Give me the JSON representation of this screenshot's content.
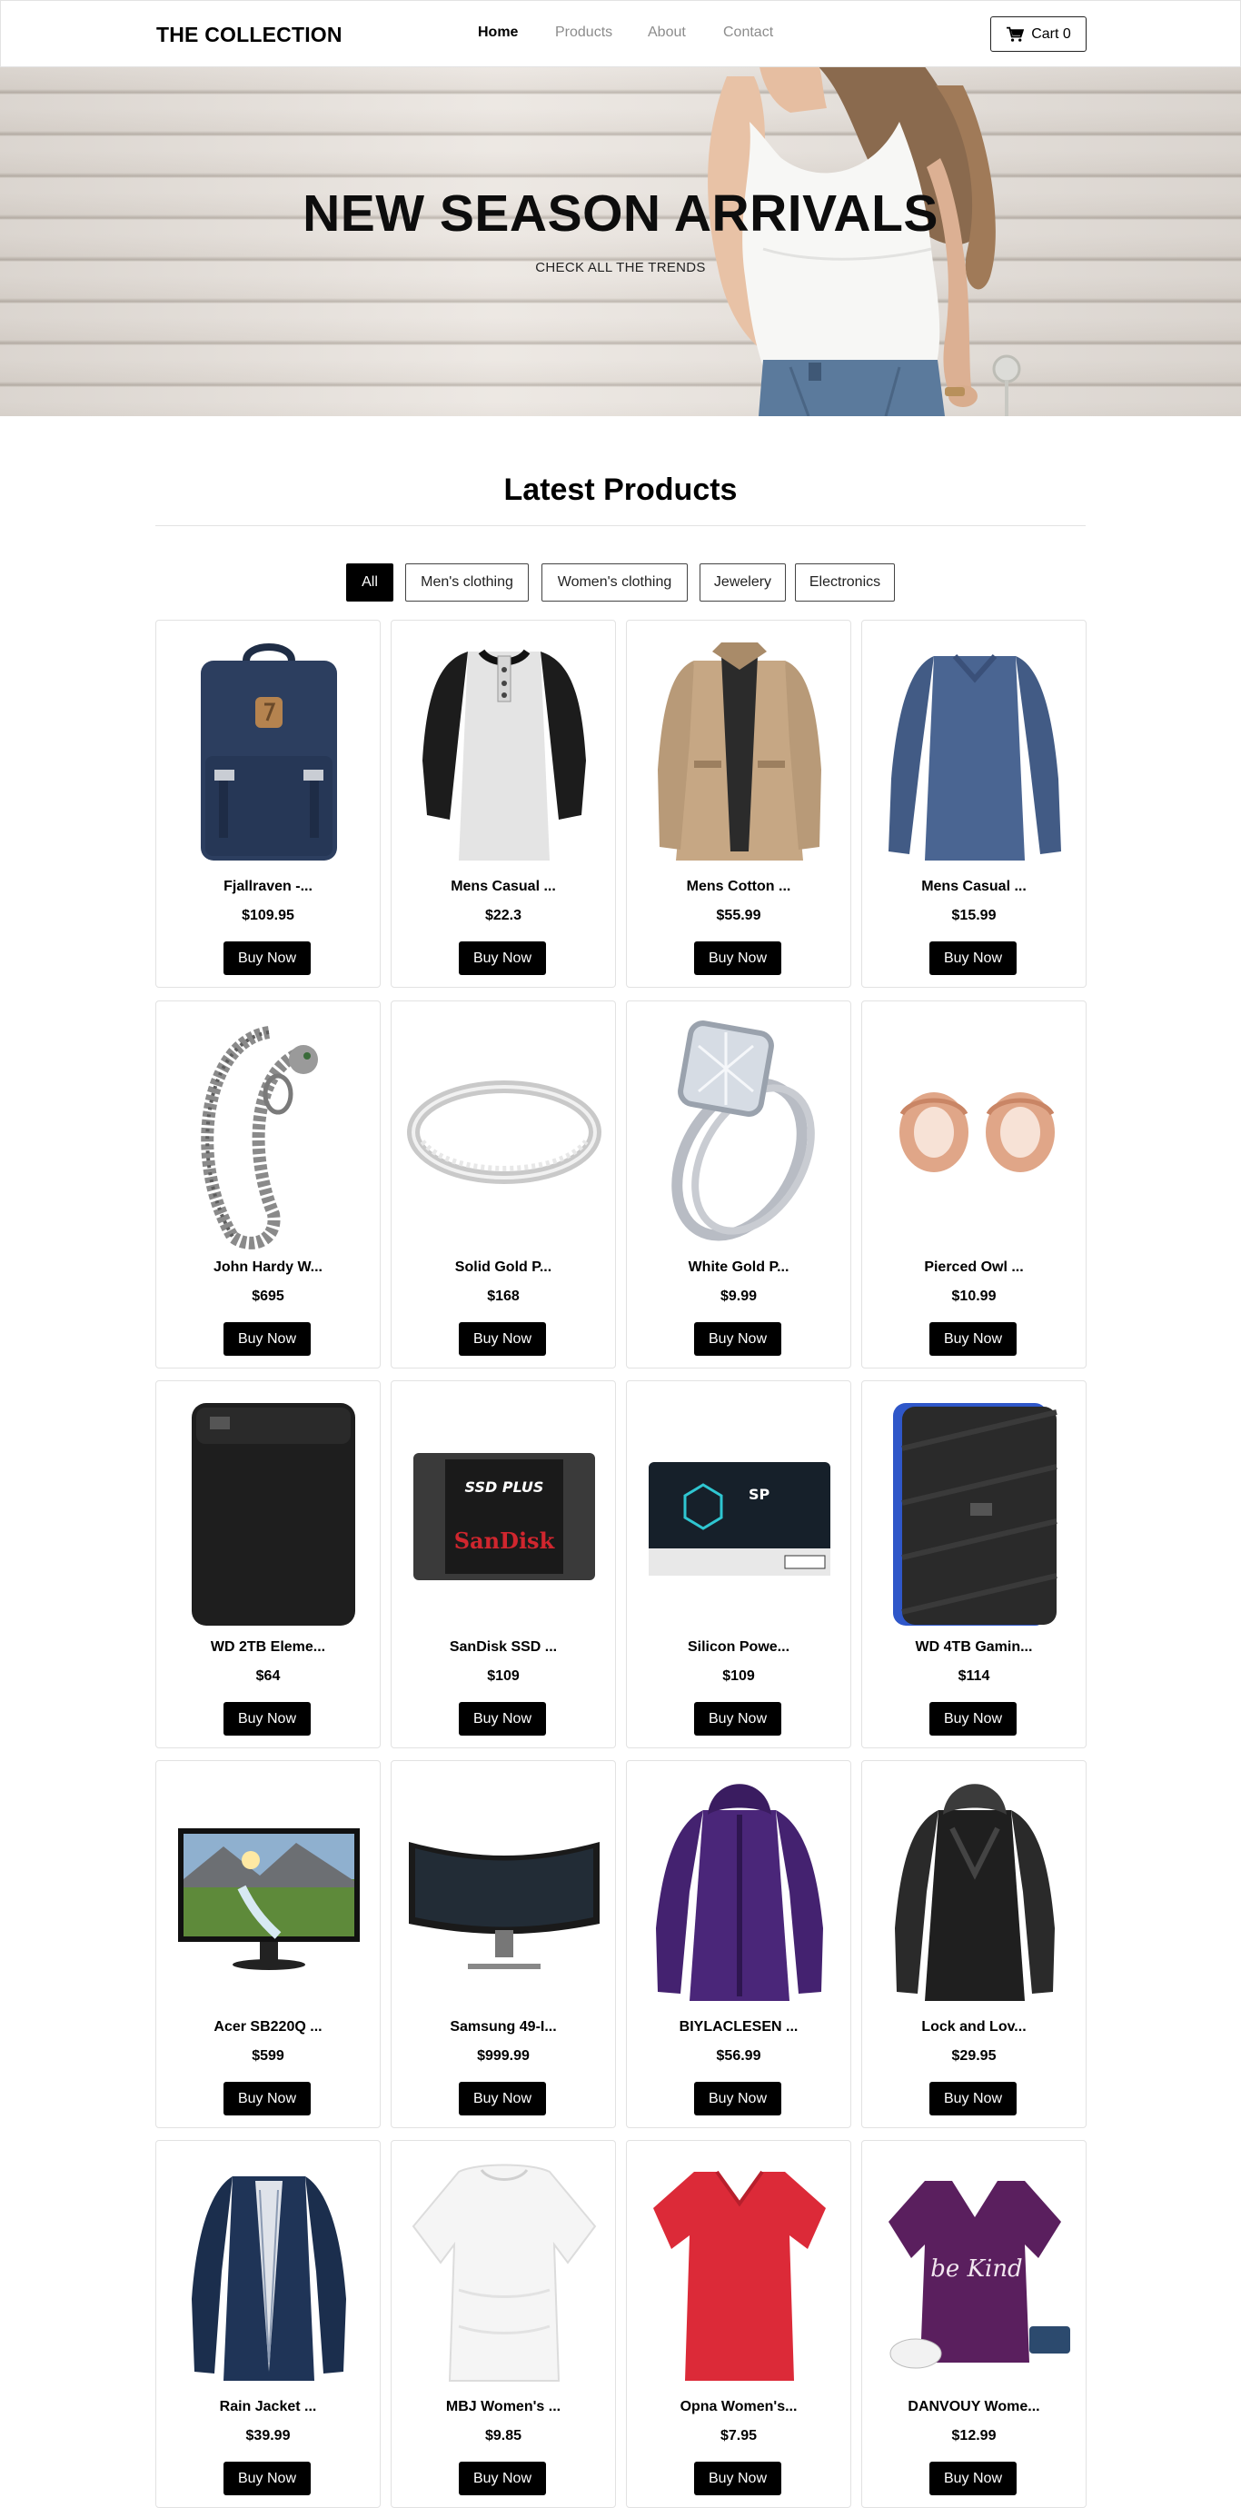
{
  "brand": "THE COLLECTION",
  "nav": {
    "links": [
      "Home",
      "Products",
      "About",
      "Contact"
    ],
    "active_index": 0,
    "cart_label": "Cart 0"
  },
  "hero": {
    "title": "NEW SEASON ARRIVALS",
    "subtitle": "CHECK ALL THE TRENDS"
  },
  "section": {
    "title": "Latest Products"
  },
  "filters": {
    "items": [
      "All",
      "Men's clothing",
      "Women's clothing",
      "Jewelery",
      "Electronics"
    ],
    "active_index": 0
  },
  "buy_label": "Buy Now",
  "products": [
    {
      "title": "Fjallraven -...",
      "price": "$109.95",
      "icon": "backpack-icon"
    },
    {
      "title": "Mens Casual ...",
      "price": "$22.3",
      "icon": "raglan-tshirt-icon"
    },
    {
      "title": "Mens Cotton ...",
      "price": "$55.99",
      "icon": "jacket-icon"
    },
    {
      "title": "Mens Casual ...",
      "price": "$15.99",
      "icon": "longsleeve-icon"
    },
    {
      "title": "John Hardy W...",
      "price": "$695",
      "icon": "bracelet-icon"
    },
    {
      "title": "Solid Gold P...",
      "price": "$168",
      "icon": "band-ring-icon"
    },
    {
      "title": "White Gold P...",
      "price": "$9.99",
      "icon": "diamond-ring-icon"
    },
    {
      "title": "Pierced Owl ...",
      "price": "$10.99",
      "icon": "plugs-icon"
    },
    {
      "title": "WD 2TB Eleme...",
      "price": "$64",
      "icon": "hard-drive-icon"
    },
    {
      "title": "SanDisk SSD ...",
      "price": "$109",
      "icon": "ssd-icon"
    },
    {
      "title": "Silicon Powe...",
      "price": "$109",
      "icon": "ssd-sp-icon"
    },
    {
      "title": "WD 4TB Gamin...",
      "price": "$114",
      "icon": "gaming-drive-icon"
    },
    {
      "title": "Acer SB220Q ...",
      "price": "$599",
      "icon": "monitor-icon"
    },
    {
      "title": "Samsung 49-I...",
      "price": "$999.99",
      "icon": "curved-monitor-icon"
    },
    {
      "title": "BIYLACLESEN ...",
      "price": "$56.99",
      "icon": "purple-jacket-icon"
    },
    {
      "title": "Lock and Lov...",
      "price": "$29.95",
      "icon": "leather-jacket-icon"
    },
    {
      "title": "Rain Jacket ...",
      "price": "$39.99",
      "icon": "rain-jacket-icon"
    },
    {
      "title": "MBJ Women's ...",
      "price": "$9.85",
      "icon": "white-top-icon"
    },
    {
      "title": "Opna Women's...",
      "price": "$7.95",
      "icon": "red-tshirt-icon"
    },
    {
      "title": "DANVOUY Wome...",
      "price": "$12.99",
      "icon": "purple-tshirt-icon"
    }
  ],
  "product_image_text": {
    "sandisk_top": "SSD PLUS",
    "sandisk_logo": "SanDisk",
    "sp_logo": "SP",
    "tee_text": "be Kind"
  }
}
